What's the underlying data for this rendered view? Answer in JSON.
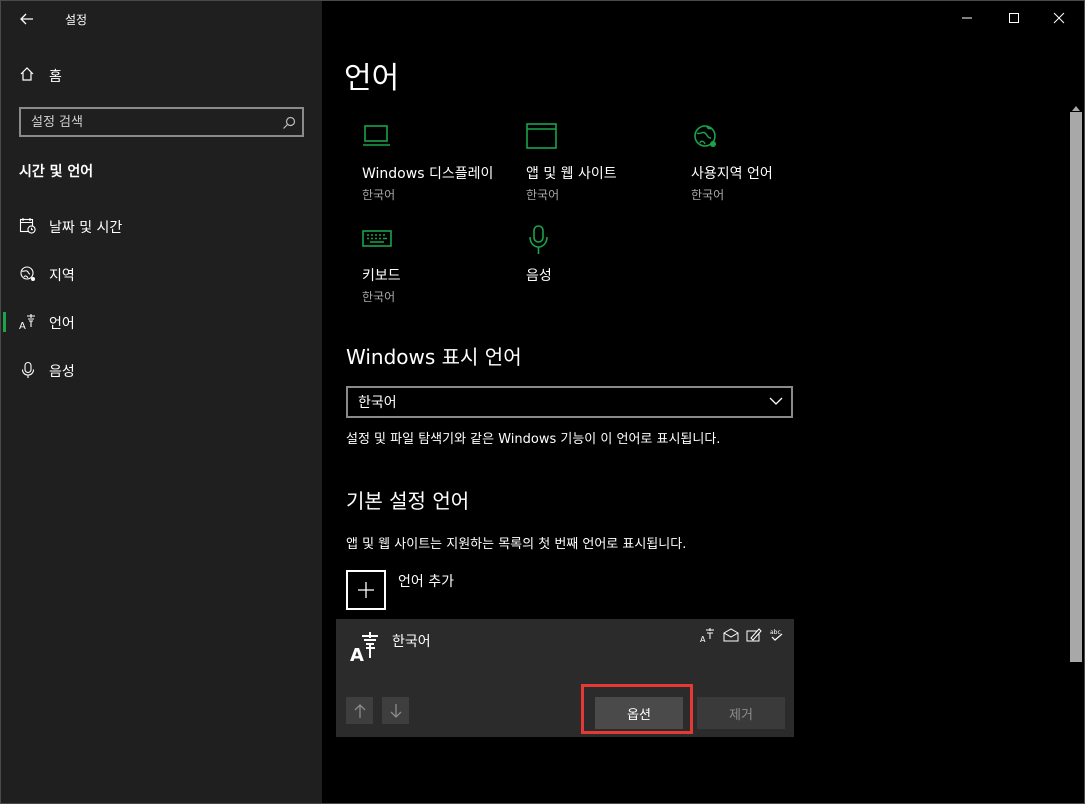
{
  "app": {
    "title": "설정"
  },
  "sidebar": {
    "home_label": "홈",
    "search_placeholder": "설정 검색",
    "section_title": "시간 및 언어",
    "items": [
      {
        "label": "날짜 및 시간",
        "icon": "calendar-clock-icon"
      },
      {
        "label": "지역",
        "icon": "globe-icon"
      },
      {
        "label": "언어",
        "icon": "language-icon",
        "selected": true
      },
      {
        "label": "음성",
        "icon": "microphone-icon"
      }
    ]
  },
  "main": {
    "title": "언어",
    "tiles": [
      {
        "label": "Windows 디스플레이",
        "sub": "한국어",
        "icon": "monitor-icon"
      },
      {
        "label": "앱 및 웹 사이트",
        "sub": "한국어",
        "icon": "browser-window-icon"
      },
      {
        "label": "사용지역 언어",
        "sub": "한국어",
        "icon": "globe-icon"
      },
      {
        "label": "키보드",
        "sub": "한국어",
        "icon": "keyboard-icon"
      },
      {
        "label": "음성",
        "sub": "",
        "icon": "microphone-icon"
      }
    ],
    "display_lang": {
      "heading": "Windows 표시 언어",
      "selected": "한국어",
      "desc": "설정 및 파일 탐색기와 같은 Windows 기능이 이 언어로 표시됩니다."
    },
    "preferred": {
      "heading": "기본 설정 언어",
      "desc": "앱 및 웹 사이트는 지원하는 목록의 첫 번째 언어로 표시됩니다.",
      "add_label": "언어 추가",
      "language": {
        "name": "한국어",
        "options_label": "옵션",
        "remove_label": "제거"
      }
    }
  },
  "colors": {
    "accent": "#1aa34a",
    "highlight": "#e53935"
  }
}
